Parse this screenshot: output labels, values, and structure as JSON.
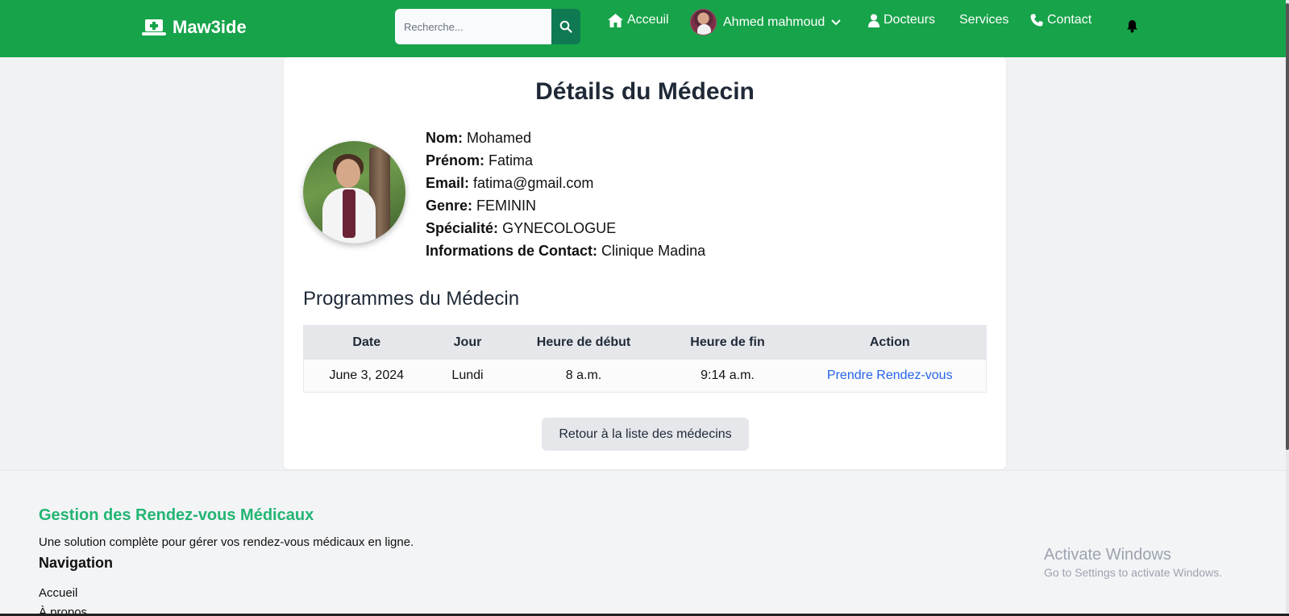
{
  "colors": {
    "nav_bg": "#17a34a",
    "search_button": "#0f7a52",
    "link": "#2563eb",
    "footer_title": "#22b573"
  },
  "navbar": {
    "brand": "Maw3ide",
    "search_placeholder": "Recherche...",
    "links": {
      "home": "Acceuil",
      "doctors": "Docteurs",
      "services": "Services",
      "contact": "Contact"
    },
    "user_name": "Ahmed mahmoud"
  },
  "doctor": {
    "page_title": "Détails du Médecin",
    "fields": [
      {
        "label": "Nom:",
        "value": "Mohamed"
      },
      {
        "label": "Prénom:",
        "value": "Fatima"
      },
      {
        "label": "Email:",
        "value": "fatima@gmail.com"
      },
      {
        "label": "Genre:",
        "value": "FEMININ"
      },
      {
        "label": "Spécialité:",
        "value": "GYNECOLOGUE"
      },
      {
        "label": "Informations de Contact:",
        "value": "Clinique Madina"
      }
    ]
  },
  "programs": {
    "title": "Programmes du Médecin",
    "headers": [
      "Date",
      "Jour",
      "Heure de début",
      "Heure de fin",
      "Action"
    ],
    "rows": [
      {
        "date": "June 3, 2024",
        "day": "Lundi",
        "start": "8 a.m.",
        "end": "9:14 a.m.",
        "action": "Prendre Rendez-vous"
      }
    ],
    "back_button": "Retour à la liste des médecins"
  },
  "footer": {
    "title": "Gestion des Rendez-vous Médicaux",
    "description": "Une solution complète pour gérer vos rendez-vous médicaux en ligne.",
    "nav_title": "Navigation",
    "links": [
      "Accueil",
      "À propos"
    ]
  },
  "watermark": {
    "line1": "Activate Windows",
    "line2": "Go to Settings to activate Windows."
  }
}
